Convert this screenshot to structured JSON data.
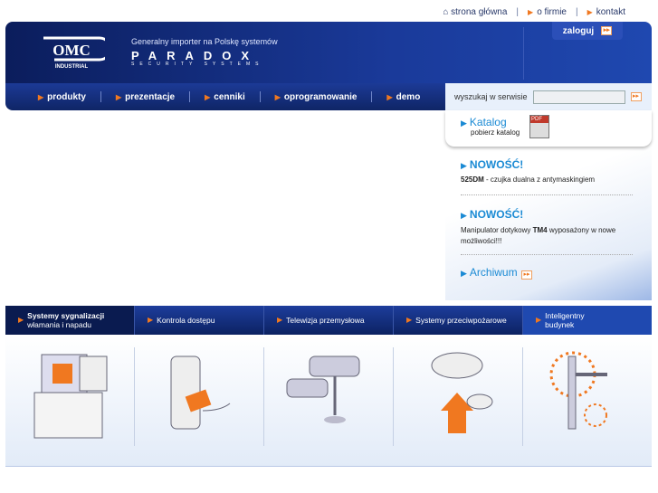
{
  "top_links": {
    "home": "strona główna",
    "about": "o firmie",
    "contact": "kontakt"
  },
  "header": {
    "login": "zaloguj",
    "tagline": "Generalny importer na Polskę systemów",
    "brand": "PARADOX",
    "brand_sub": "SECURITY SYSTEMS",
    "logo_text": "OMC",
    "logo_sub": "INDUSTRIAL"
  },
  "nav": [
    "produkty",
    "prezentacje",
    "cenniki",
    "oprogramowanie",
    "demo"
  ],
  "search": {
    "label": "wyszukaj w serwisie",
    "value": ""
  },
  "catalog": {
    "title": "Katalog",
    "subtitle": "pobierz katalog",
    "pdf": "PDF"
  },
  "news": [
    {
      "title": "NOWOŚĆ!",
      "bold": "525DM",
      "text": " - czujka dualna z antymaskingiem",
      "after": ""
    },
    {
      "title": "NOWOŚĆ!",
      "bold": "TM4",
      "text": "Manipulator dotykowy ",
      "after": " wyposażony w nowe możliwości!!!"
    }
  ],
  "archive": "Archiwum",
  "categories": [
    {
      "line1": "Systemy sygnalizacji",
      "line2": "włamania i napadu"
    },
    {
      "line1": "Kontrola dostępu",
      "line2": ""
    },
    {
      "line1": "Telewizja przemysłowa",
      "line2": ""
    },
    {
      "line1": "Systemy przeciwpożarowe",
      "line2": ""
    },
    {
      "line1": "Inteligentny",
      "line2": "budynek"
    }
  ]
}
